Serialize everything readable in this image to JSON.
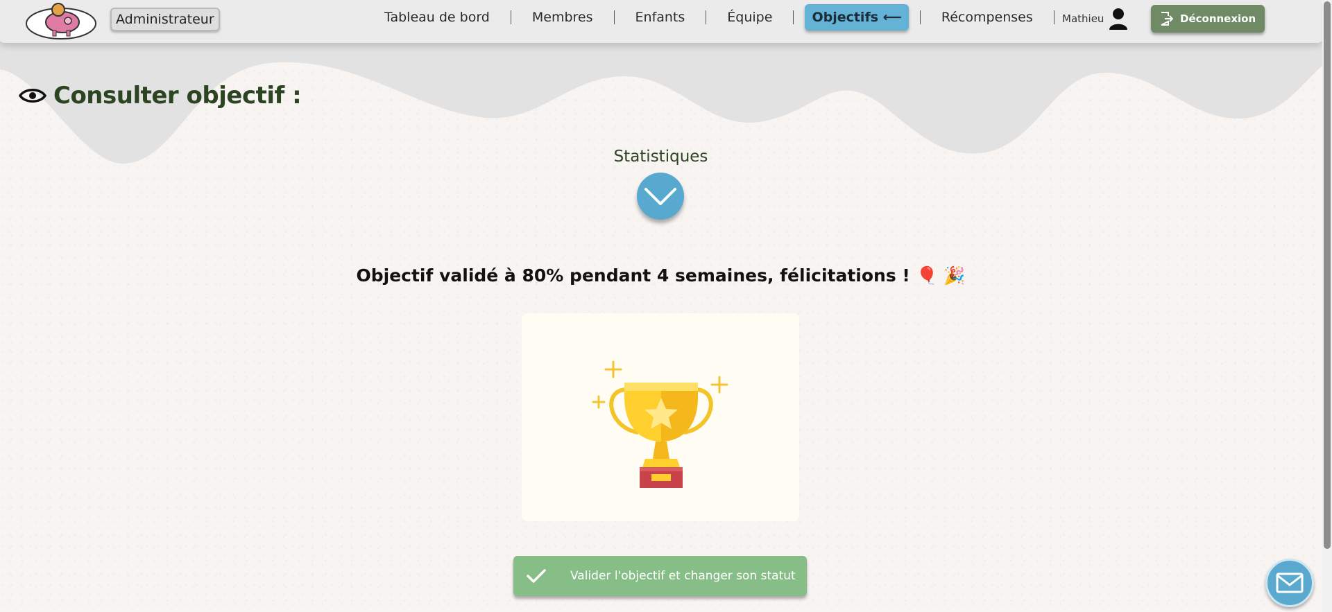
{
  "header": {
    "logo_icon": "piggy-bank-logo",
    "role": "Administrateur",
    "nav": [
      {
        "label": "Tableau de bord",
        "active": false
      },
      {
        "label": "Membres",
        "active": false
      },
      {
        "label": "Enfants",
        "active": false
      },
      {
        "label": "Équipe",
        "active": false
      },
      {
        "label": "Objectifs ⟵",
        "active": true
      },
      {
        "label": "Récompenses",
        "active": false
      }
    ],
    "user_name": "Mathieu",
    "logout_label": "Déconnexion"
  },
  "main": {
    "title": "Consulter objectif :",
    "stats_label": "Statistiques",
    "message": "Objectif validé à 80% pendant 4 semaines, félicitations ! 🎈 🎉",
    "validate_label": "Valider l'objectif et changer son statut"
  },
  "colors": {
    "accent_blue": "#58a9cf",
    "validate_green": "#87bd87",
    "logout_green": "#6f8a64",
    "title_green": "#2d4423"
  }
}
